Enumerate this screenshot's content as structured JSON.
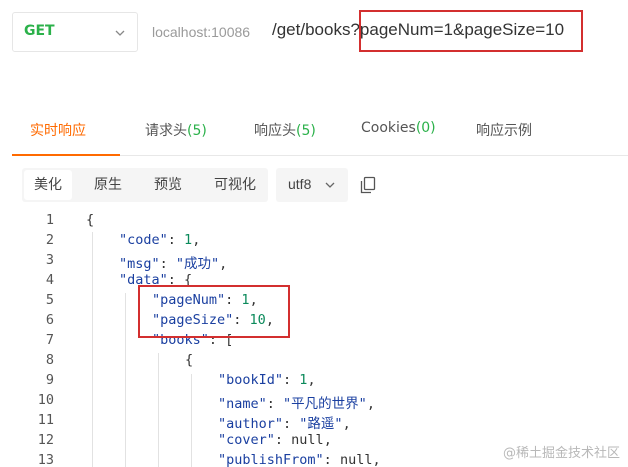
{
  "request": {
    "method": "GET",
    "host": "localhost:10086",
    "path": "/get/books",
    "query": "?pageNum=1&pageSize=10"
  },
  "tabs": [
    {
      "label": "实时响应",
      "count": ""
    },
    {
      "label": "请求头",
      "count": "(5)"
    },
    {
      "label": "响应头",
      "count": "(5)"
    },
    {
      "label": "Cookies",
      "count": "(0)"
    },
    {
      "label": "响应示例",
      "count": ""
    }
  ],
  "toolbar": {
    "views": [
      "美化",
      "原生",
      "预览",
      "可视化"
    ],
    "encoding": "utf8"
  },
  "code_lines": [
    {
      "n": "1"
    },
    {
      "n": "2"
    },
    {
      "n": "3"
    },
    {
      "n": "4"
    },
    {
      "n": "5"
    },
    {
      "n": "6"
    },
    {
      "n": "7"
    },
    {
      "n": "8"
    },
    {
      "n": "9"
    },
    {
      "n": "10"
    },
    {
      "n": "11"
    },
    {
      "n": "12"
    },
    {
      "n": "13"
    }
  ],
  "response": {
    "open": "{",
    "code_key": "\"code\"",
    "code_val": "1",
    "msg_key": "\"msg\"",
    "msg_val": "\"成功\"",
    "data_key": "\"data\"",
    "pageNum_key": "\"pageNum\"",
    "pageNum_val": "1",
    "pageSize_key": "\"pageSize\"",
    "pageSize_val": "10",
    "books_key": "\"books\"",
    "book_open": "{",
    "bookId_key": "\"bookId\"",
    "bookId_val": "1",
    "name_key": "\"name\"",
    "name_val": "\"平凡的世界\"",
    "author_key": "\"author\"",
    "author_val": "\"路遥\"",
    "cover_key": "\"cover\"",
    "cover_val": "null",
    "publishFrom_key": "\"publishFrom\"",
    "publishFrom_val": "null"
  },
  "watermark": "@稀土掘金技术社区",
  "colors": {
    "accent": "#ff6a00",
    "get": "#2bb14a",
    "highlight": "#d32f2f"
  }
}
